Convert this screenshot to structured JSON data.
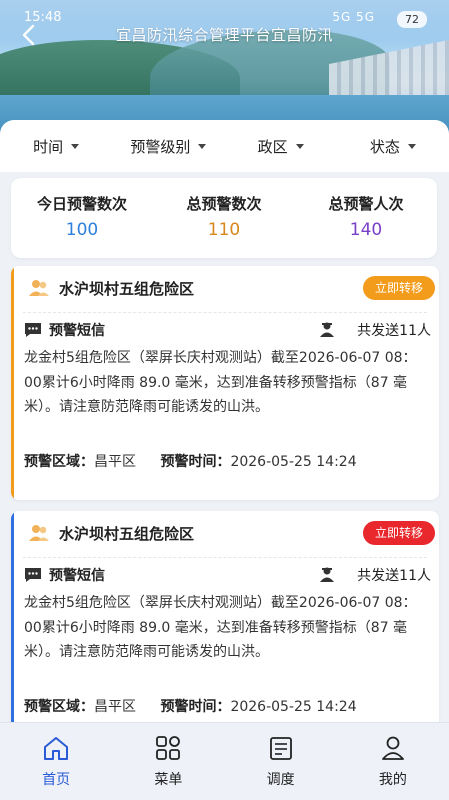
{
  "status_bar": {
    "time": "15:48",
    "signal_text": "5G 5G",
    "battery": "72"
  },
  "nav": {
    "title": "宜昌防汛综合管理平台宜昌防汛"
  },
  "filters": [
    {
      "label": "时间"
    },
    {
      "label": "预警级别"
    },
    {
      "label": "政区"
    },
    {
      "label": "状态"
    }
  ],
  "stats": [
    {
      "label": "今日预警数次",
      "value": "100",
      "color": "#2f7fdc"
    },
    {
      "label": "总预警数次",
      "value": "110",
      "color": "#d8871c"
    },
    {
      "label": "总预警人次",
      "value": "140",
      "color": "#7a3fc8"
    }
  ],
  "cards": [
    {
      "title": "水沪坝村五组危险区",
      "button": "立即转移",
      "button_color": "#f39c1c",
      "accent_color": "#f39c1c",
      "sms_label": "预警短信",
      "sent_text": "共发送11人",
      "message": "龙金村5组危险区（翠屏长庆村观测站）截至2026-06-07 08：00累计6小时降雨 89.0 毫米，达到准备转移预警指标（87 毫米）。请注意防范降雨可能诱发的山洪。",
      "region_label": "预警区域：",
      "region": "昌平区",
      "time_label": "预警时间：",
      "time": "2026-05-25 14:24"
    },
    {
      "title": "水沪坝村五组危险区",
      "button": "立即转移",
      "button_color": "#e8282d",
      "accent_color": "#2f6fe0",
      "sms_label": "预警短信",
      "sent_text": "共发送11人",
      "message": "龙金村5组危险区（翠屏长庆村观测站）截至2026-06-07 08：00累计6小时降雨 89.0 毫米，达到准备转移预警指标（87 毫米）。请注意防范降雨可能诱发的山洪。",
      "region_label": "预警区域：",
      "region": "昌平区",
      "time_label": "预警时间：",
      "time": "2026-05-25 14:24"
    }
  ],
  "tabs": [
    {
      "label": "首页",
      "icon": "home-icon",
      "active": true
    },
    {
      "label": "菜单",
      "icon": "grid-icon",
      "active": false
    },
    {
      "label": "调度",
      "icon": "clipboard-icon",
      "active": false
    },
    {
      "label": "我的",
      "icon": "user-icon",
      "active": false
    }
  ]
}
